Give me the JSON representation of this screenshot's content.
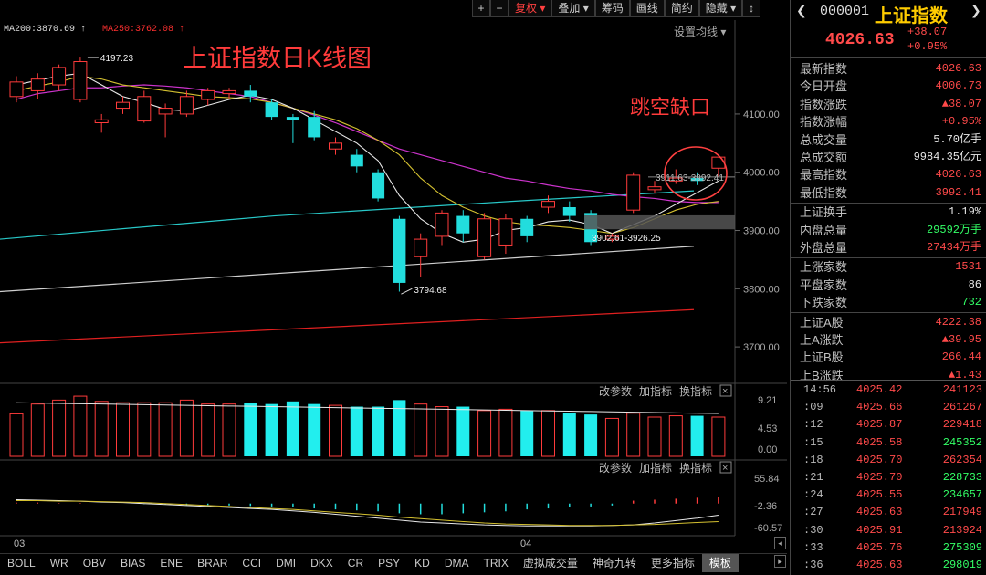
{
  "toolbar": {
    "items": [
      {
        "label": "+",
        "square": true
      },
      {
        "label": "−",
        "square": true
      },
      {
        "label": "复权 ▾",
        "active": true
      },
      {
        "label": "叠加 ▾"
      },
      {
        "label": "筹码"
      },
      {
        "label": "画线"
      },
      {
        "label": "简约"
      },
      {
        "label": "隐藏 ▾"
      },
      {
        "label": "↕",
        "square": true
      }
    ]
  },
  "main_chart": {
    "ma_legend": [
      {
        "text": "MA200:3870.69 ↑",
        "color": "#e0e0e0"
      },
      {
        "text": "MA250:3762.08 ↑",
        "color": "#ff3030"
      }
    ],
    "settings_label": "设置均线 ▾",
    "annotation_title": "上证指数日K线图",
    "annotation_gap": "跳空缺口",
    "high_label": "4197.23",
    "low_label": "3794.68",
    "range_label_1": "3902.61-3926.25",
    "range_label_2": "3911.63-3992.41"
  },
  "sub1": {
    "buttons": [
      "改参数",
      "加指标",
      "换指标"
    ],
    "close": "×",
    "scale": [
      "9.21",
      "4.53",
      "0.00"
    ]
  },
  "sub2": {
    "buttons": [
      "改参数",
      "加指标",
      "换指标"
    ],
    "close": "×",
    "scale": [
      "55.84",
      "-2.36",
      "-60.57"
    ]
  },
  "x_labels": [
    "03",
    "04"
  ],
  "chart_data": {
    "type": "candlestick",
    "ylim": [
      3650,
      4230
    ],
    "y_ticks": [
      "4100.00",
      "4000.00",
      "3900.00",
      "3800.00",
      "3700.00"
    ],
    "candles": [
      {
        "o": 4130,
        "c": 4155,
        "h": 4165,
        "l": 4120
      },
      {
        "o": 4140,
        "c": 4160,
        "h": 4170,
        "l": 4125
      },
      {
        "o": 4150,
        "c": 4180,
        "h": 4185,
        "l": 4140
      },
      {
        "o": 4125,
        "c": 4190,
        "h": 4197,
        "l": 4120
      },
      {
        "o": 4085,
        "c": 4090,
        "h": 4100,
        "l": 4068
      },
      {
        "o": 4110,
        "c": 4120,
        "h": 4130,
        "l": 4100
      },
      {
        "o": 4088,
        "c": 4130,
        "h": 4140,
        "l": 4085
      },
      {
        "o": 4100,
        "c": 4110,
        "h": 4118,
        "l": 4060
      },
      {
        "o": 4100,
        "c": 4130,
        "h": 4140,
        "l": 4095
      },
      {
        "o": 4125,
        "c": 4140,
        "h": 4145,
        "l": 4115
      },
      {
        "o": 4135,
        "c": 4140,
        "h": 4145,
        "l": 4125
      },
      {
        "o": 4140,
        "c": 4130,
        "h": 4150,
        "l": 4120
      },
      {
        "o": 4120,
        "c": 4095,
        "h": 4125,
        "l": 4090
      },
      {
        "o": 4095,
        "c": 4090,
        "h": 4100,
        "l": 4050
      },
      {
        "o": 4095,
        "c": 4060,
        "h": 4105,
        "l": 4055
      },
      {
        "o": 4040,
        "c": 4050,
        "h": 4060,
        "l": 4030
      },
      {
        "o": 4030,
        "c": 4010,
        "h": 4040,
        "l": 4000
      },
      {
        "o": 4000,
        "c": 3955,
        "h": 4005,
        "l": 3950
      },
      {
        "o": 3920,
        "c": 3810,
        "h": 3925,
        "l": 3795
      },
      {
        "o": 3855,
        "c": 3885,
        "h": 3895,
        "l": 3820
      },
      {
        "o": 3890,
        "c": 3930,
        "h": 3935,
        "l": 3875
      },
      {
        "o": 3925,
        "c": 3895,
        "h": 3935,
        "l": 3880
      },
      {
        "o": 3855,
        "c": 3920,
        "h": 3930,
        "l": 3850
      },
      {
        "o": 3875,
        "c": 3920,
        "h": 3928,
        "l": 3860
      },
      {
        "o": 3920,
        "c": 3890,
        "h": 3925,
        "l": 3880
      },
      {
        "o": 3940,
        "c": 3950,
        "h": 3960,
        "l": 3930
      },
      {
        "o": 3940,
        "c": 3925,
        "h": 3950,
        "l": 3915
      },
      {
        "o": 3930,
        "c": 3880,
        "h": 3935,
        "l": 3875
      },
      {
        "o": 3885,
        "c": 3890,
        "h": 3895,
        "l": 3880
      },
      {
        "o": 3935,
        "c": 3995,
        "h": 4000,
        "l": 3930
      },
      {
        "o": 3970,
        "c": 3975,
        "h": 3985,
        "l": 3965
      },
      {
        "o": 3985,
        "c": 3990,
        "h": 4005,
        "l": 3980
      },
      {
        "o": 3990,
        "c": 3985,
        "h": 4000,
        "l": 3978
      },
      {
        "o": 4007,
        "c": 4026,
        "h": 4026,
        "l": 3992
      }
    ],
    "volumes": [
      6.5,
      8.0,
      8.6,
      9.2,
      8.4,
      8.2,
      8.2,
      8.2,
      8.6,
      8.0,
      8.0,
      8.2,
      8.0,
      8.4,
      8.0,
      7.8,
      7.6,
      7.6,
      8.6,
      8.0,
      7.6,
      7.6,
      7.0,
      7.2,
      7.0,
      7.0,
      6.6,
      6.4,
      5.8,
      6.6,
      6.0,
      6.2,
      6.2,
      6.0
    ],
    "macd": [
      2,
      2,
      1,
      1,
      0,
      0,
      -1,
      -2,
      -3,
      -3,
      -4,
      -5,
      -6,
      -8,
      -10,
      -12,
      -14,
      -16,
      -20,
      -22,
      -22,
      -20,
      -18,
      -16,
      -12,
      -10,
      -8,
      -6,
      -4,
      6,
      8,
      10,
      12,
      14
    ],
    "macd_ylim": [
      -60.57,
      55.84
    ]
  },
  "bottom_tabs": [
    "BOLL",
    "WR",
    "OBV",
    "BIAS",
    "ENE",
    "BRAR",
    "CCI",
    "DMI",
    "DKX",
    "CR",
    "PSY",
    "KD",
    "DMA",
    "TRIX",
    "虚拟成交量",
    "神奇九转",
    "更多指标",
    "模板"
  ],
  "panel": {
    "code": "000001",
    "name": "上证指数",
    "price": "4026.63",
    "change": "+38.07",
    "change_pct": "+0.95%",
    "stats": [
      {
        "label": "最新指数",
        "value": "4026.63",
        "color": "#ff4a4a"
      },
      {
        "label": "今日开盘",
        "value": "4006.73",
        "color": "#ff4a4a"
      },
      {
        "label": "指数涨跌",
        "value": "▲38.07",
        "color": "#ff4a4a"
      },
      {
        "label": "指数涨幅",
        "value": "+0.95%",
        "color": "#ff4a4a"
      },
      {
        "label": "总成交量",
        "value": "5.70亿手",
        "color": "#e8e8e8"
      },
      {
        "label": "总成交额",
        "value": "9984.35亿元",
        "color": "#e8e8e8"
      },
      {
        "label": "最高指数",
        "value": "4026.63",
        "color": "#ff4a4a"
      },
      {
        "label": "最低指数",
        "value": "3992.41",
        "color": "#ff4a4a"
      },
      {
        "label": "上证换手",
        "value": "1.19%",
        "color": "#e8e8e8"
      },
      {
        "label": "内盘总量",
        "value": "29592万手",
        "color": "#33ff66"
      },
      {
        "label": "外盘总量",
        "value": "27434万手",
        "color": "#ff4a4a"
      },
      {
        "label": "上涨家数",
        "value": "1531",
        "color": "#ff4a4a"
      },
      {
        "label": "平盘家数",
        "value": "86",
        "color": "#e8e8e8"
      },
      {
        "label": "下跌家数",
        "value": "732",
        "color": "#33ff66"
      },
      {
        "label": "上证A股",
        "value": "4222.38",
        "color": "#ff4a4a"
      },
      {
        "label": "上A涨跌",
        "value": "▲39.95",
        "color": "#ff4a4a"
      },
      {
        "label": "上证B股",
        "value": "266.44",
        "color": "#ff4a4a"
      },
      {
        "label": "上B涨跌",
        "value": "▲1.43",
        "color": "#ff4a4a"
      }
    ],
    "ticks": [
      {
        "time": "14:56",
        "price": "4025.42",
        "vol": "241123",
        "color": "#ff4a4a"
      },
      {
        "time": ":09",
        "price": "4025.66",
        "vol": "261267",
        "color": "#ff4a4a"
      },
      {
        "time": ":12",
        "price": "4025.87",
        "vol": "229418",
        "color": "#ff4a4a"
      },
      {
        "time": ":15",
        "price": "4025.58",
        "vol": "245352",
        "color": "#33ff66"
      },
      {
        "time": ":18",
        "price": "4025.70",
        "vol": "262354",
        "color": "#ff4a4a"
      },
      {
        "time": ":21",
        "price": "4025.70",
        "vol": "228733",
        "color": "#33ff66"
      },
      {
        "time": ":24",
        "price": "4025.55",
        "vol": "234657",
        "color": "#33ff66"
      },
      {
        "time": ":27",
        "price": "4025.63",
        "vol": "217949",
        "color": "#ff4a4a"
      },
      {
        "time": ":30",
        "price": "4025.91",
        "vol": "213924",
        "color": "#ff4a4a"
      },
      {
        "time": ":33",
        "price": "4025.76",
        "vol": "275309",
        "color": "#33ff66"
      },
      {
        "time": ":36",
        "price": "4025.63",
        "vol": "298019",
        "color": "#33ff66"
      }
    ]
  }
}
